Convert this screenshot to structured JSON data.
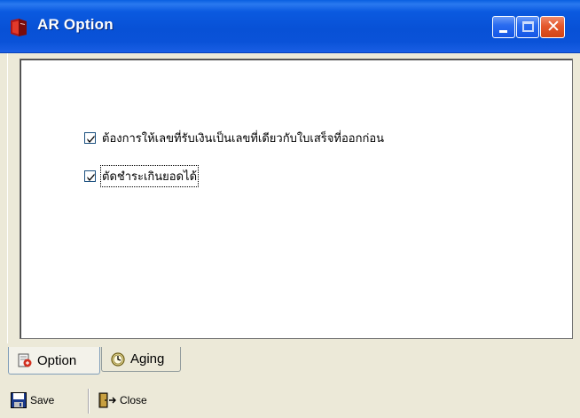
{
  "window": {
    "title": "AR Option",
    "controls": {
      "minimize": "minimize-icon",
      "maximize": "maximize-icon",
      "close": "close-icon",
      "close_glyph": "✕"
    }
  },
  "options": [
    {
      "label": "ต้องการให้เลขที่รับเงินเป็นเลขที่เดียวกับใบเสร็จที่ออกก่อน",
      "checked": true
    },
    {
      "label": "ตัดชำระเกินยอดได้",
      "checked": true
    }
  ],
  "tabs": [
    {
      "label": "Option",
      "icon": "option-tab-icon",
      "active": true
    },
    {
      "label": "Aging",
      "icon": "clock-icon",
      "active": false
    }
  ],
  "toolbar": {
    "save_label": "Save",
    "close_label": "Close"
  },
  "colors": {
    "titlebar": "#0851d6",
    "window_bg": "#ece9d8",
    "panel_bg": "#ffffff",
    "close_button": "#e4582c"
  }
}
